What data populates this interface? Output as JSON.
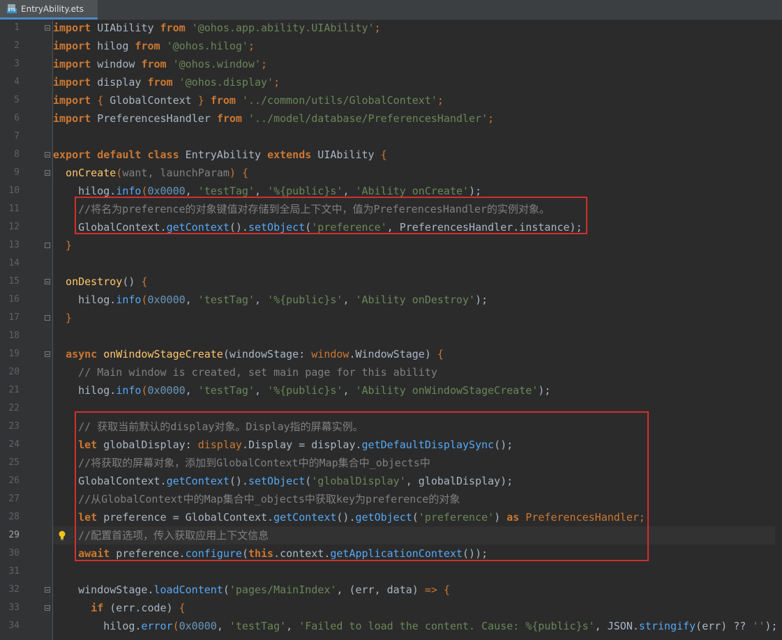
{
  "tab": {
    "filename": "EntryAbility.ets",
    "icon_badge": "ETS"
  },
  "current_line": 29,
  "lines": [
    [
      [
        "import",
        "k"
      ],
      [
        " UIAbility ",
        ""
      ],
      [
        "from",
        "k"
      ],
      [
        " ",
        ""
      ],
      [
        "'@ohos.app.ability.UIAbility'",
        "s"
      ],
      [
        ";",
        "p"
      ]
    ],
    [
      [
        "import",
        "k"
      ],
      [
        " hilog ",
        ""
      ],
      [
        "from",
        "k"
      ],
      [
        " ",
        ""
      ],
      [
        "'@ohos.hilog'",
        "s"
      ],
      [
        ";",
        "p"
      ]
    ],
    [
      [
        "import",
        "k"
      ],
      [
        " window ",
        ""
      ],
      [
        "from",
        "k"
      ],
      [
        " ",
        ""
      ],
      [
        "'@ohos.window'",
        "s"
      ],
      [
        ";",
        "p"
      ]
    ],
    [
      [
        "import",
        "k"
      ],
      [
        " display ",
        ""
      ],
      [
        "from",
        "k"
      ],
      [
        " ",
        ""
      ],
      [
        "'@ohos.display'",
        "s"
      ],
      [
        ";",
        "p"
      ]
    ],
    [
      [
        "import",
        "k"
      ],
      [
        " ",
        ""
      ],
      [
        "{",
        "p"
      ],
      [
        " GlobalContext ",
        ""
      ],
      [
        "}",
        "p"
      ],
      [
        " ",
        ""
      ],
      [
        "from",
        "k"
      ],
      [
        " ",
        ""
      ],
      [
        "'../common/utils/GlobalContext'",
        "s"
      ],
      [
        ";",
        "p"
      ]
    ],
    [
      [
        "import",
        "k"
      ],
      [
        " PreferencesHandler ",
        ""
      ],
      [
        "from",
        "k"
      ],
      [
        " ",
        ""
      ],
      [
        "'../model/database/PreferencesHandler'",
        "s"
      ],
      [
        ";",
        "p"
      ]
    ],
    [],
    [
      [
        "export",
        "k"
      ],
      [
        " ",
        ""
      ],
      [
        "default",
        "k"
      ],
      [
        " ",
        ""
      ],
      [
        "class",
        "k"
      ],
      [
        " EntryAbility ",
        ""
      ],
      [
        "extends",
        "k"
      ],
      [
        " UIAbility ",
        ""
      ],
      [
        "{",
        "p"
      ]
    ],
    [
      [
        "  onCreate",
        "f"
      ],
      [
        "(",
        "p"
      ],
      [
        "want, launchParam",
        "c"
      ],
      [
        ")",
        "p"
      ],
      [
        " ",
        ""
      ],
      [
        "{",
        "p"
      ]
    ],
    [
      [
        "    hilog.",
        ""
      ],
      [
        "info",
        "m"
      ],
      [
        "(",
        "p"
      ],
      [
        "0x0000",
        "n"
      ],
      [
        ", ",
        ""
      ],
      [
        "'testTag'",
        "s"
      ],
      [
        ", ",
        ""
      ],
      [
        "'%{public}s'",
        "s"
      ],
      [
        ", ",
        ""
      ],
      [
        "'Ability onCreate'",
        "s"
      ],
      [
        ");",
        ""
      ]
    ],
    [
      [
        "    //将名为preference的对象键值对存储到全局上下文中，值为PreferencesHandler的实例对象。",
        "c"
      ]
    ],
    [
      [
        "    GlobalContext.",
        ""
      ],
      [
        "getContext",
        "m"
      ],
      [
        "().",
        ""
      ],
      [
        "setObject",
        "m"
      ],
      [
        "(",
        ""
      ],
      [
        "'preference'",
        "s"
      ],
      [
        ", PreferencesHandler.instance);",
        ""
      ]
    ],
    [
      [
        "  }",
        "p"
      ]
    ],
    [],
    [
      [
        "  onDestroy",
        "f"
      ],
      [
        "() ",
        ""
      ],
      [
        "{",
        "p"
      ]
    ],
    [
      [
        "    hilog.",
        ""
      ],
      [
        "info",
        "m"
      ],
      [
        "(",
        "p"
      ],
      [
        "0x0000",
        "n"
      ],
      [
        ", ",
        ""
      ],
      [
        "'testTag'",
        "s"
      ],
      [
        ", ",
        ""
      ],
      [
        "'%{public}s'",
        "s"
      ],
      [
        ", ",
        ""
      ],
      [
        "'Ability onDestroy'",
        "s"
      ],
      [
        ");",
        ""
      ]
    ],
    [
      [
        "  }",
        "p"
      ]
    ],
    [],
    [
      [
        "  ",
        ""
      ],
      [
        "async",
        "k"
      ],
      [
        " ",
        ""
      ],
      [
        "onWindowStageCreate",
        "f"
      ],
      [
        "(windowStage: ",
        ""
      ],
      [
        "window",
        "p"
      ],
      [
        ".WindowStage) ",
        ""
      ],
      [
        "{",
        "p"
      ]
    ],
    [
      [
        "    // Main window is created, set main page for this ability",
        "c"
      ]
    ],
    [
      [
        "    hilog.",
        ""
      ],
      [
        "info",
        "m"
      ],
      [
        "(",
        "p"
      ],
      [
        "0x0000",
        "n"
      ],
      [
        ", ",
        ""
      ],
      [
        "'testTag'",
        "s"
      ],
      [
        ", ",
        ""
      ],
      [
        "'%{public}s'",
        "s"
      ],
      [
        ", ",
        ""
      ],
      [
        "'Ability onWindowStageCreate'",
        "s"
      ],
      [
        ");",
        ""
      ]
    ],
    [],
    [
      [
        "    // 获取当前默认的display对象。Display指的屏幕实例。",
        "c"
      ]
    ],
    [
      [
        "    ",
        ""
      ],
      [
        "let",
        "k"
      ],
      [
        " globalDisplay: ",
        ""
      ],
      [
        "display",
        "p"
      ],
      [
        ".Display = display.",
        ""
      ],
      [
        "getDefaultDisplaySync",
        "m"
      ],
      [
        "();",
        ""
      ]
    ],
    [
      [
        "    //将获取的屏幕对象，添加到GlobalContext中的Map集合中_objects中",
        "c"
      ]
    ],
    [
      [
        "    GlobalContext.",
        ""
      ],
      [
        "getContext",
        "m"
      ],
      [
        "().",
        ""
      ],
      [
        "setObject",
        "m"
      ],
      [
        "(",
        ""
      ],
      [
        "'globalDisplay'",
        "s"
      ],
      [
        ", globalDisplay);",
        ""
      ]
    ],
    [
      [
        "    //从GlobalContext中的Map集合中_objects中获取key为preference的对象",
        "c"
      ]
    ],
    [
      [
        "    ",
        ""
      ],
      [
        "let",
        "k"
      ],
      [
        " preference = GlobalContext.",
        ""
      ],
      [
        "getContext",
        "m"
      ],
      [
        "().",
        ""
      ],
      [
        "getObject",
        "m"
      ],
      [
        "(",
        ""
      ],
      [
        "'preference'",
        "s"
      ],
      [
        ") ",
        ""
      ],
      [
        "as",
        "k"
      ],
      [
        " ",
        ""
      ],
      [
        "PreferencesHandler",
        "p"
      ],
      [
        ";",
        "p"
      ]
    ],
    [
      [
        "    //配置首选项，传入获取应用上下文信息",
        "c"
      ]
    ],
    [
      [
        "    ",
        ""
      ],
      [
        "await",
        "k"
      ],
      [
        " preference.",
        ""
      ],
      [
        "configure",
        "m"
      ],
      [
        "(",
        ""
      ],
      [
        "this",
        "k"
      ],
      [
        ".context.",
        ""
      ],
      [
        "getApplicationContext",
        "m"
      ],
      [
        "());",
        ""
      ]
    ],
    [],
    [
      [
        "    windowStage.",
        ""
      ],
      [
        "loadContent",
        "m"
      ],
      [
        "(",
        ""
      ],
      [
        "'pages/MainIndex'",
        "s"
      ],
      [
        ", (err, data) ",
        ""
      ],
      [
        "=>",
        "p"
      ],
      [
        " ",
        ""
      ],
      [
        "{",
        "p"
      ]
    ],
    [
      [
        "      ",
        ""
      ],
      [
        "if",
        "k"
      ],
      [
        " (err.code) ",
        ""
      ],
      [
        "{",
        "p"
      ]
    ],
    [
      [
        "        hilog.",
        ""
      ],
      [
        "error",
        "m"
      ],
      [
        "(",
        "p"
      ],
      [
        "0x0000",
        "n"
      ],
      [
        ", ",
        ""
      ],
      [
        "'testTag'",
        "s"
      ],
      [
        ", ",
        ""
      ],
      [
        "'Failed to load the content. Cause: %{public}s'",
        "s"
      ],
      [
        ", JSON.",
        ""
      ],
      [
        "stringify",
        "m"
      ],
      [
        "(err) ?? ",
        ""
      ],
      [
        "''",
        "s"
      ],
      [
        ");",
        ""
      ]
    ]
  ]
}
